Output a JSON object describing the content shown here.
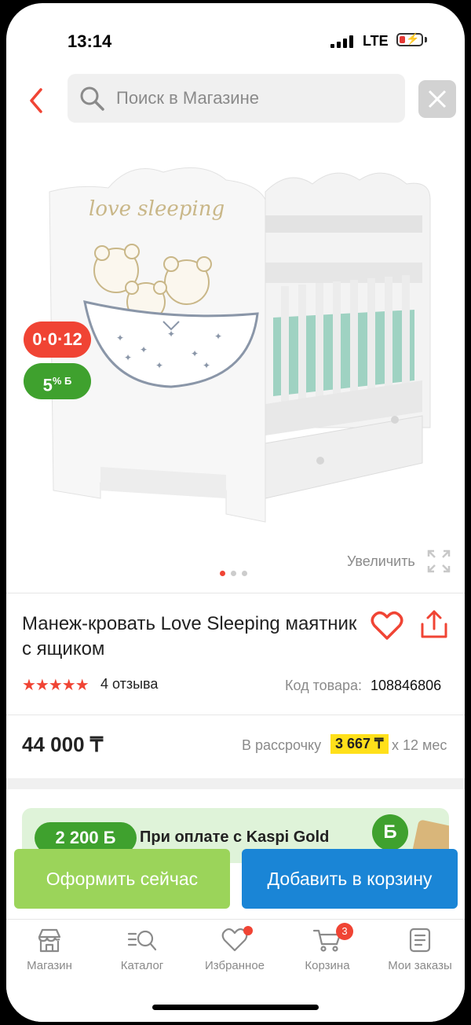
{
  "status_bar": {
    "time": "13:14",
    "network": "LTE"
  },
  "search": {
    "placeholder": "Поиск в Магазине"
  },
  "product": {
    "badges": {
      "installment": "0·0·12",
      "bonus_value": "5",
      "bonus_suffix": "% Б"
    },
    "carousel": {
      "total": 3,
      "active": 0
    },
    "zoom_label": "Увеличить",
    "title": "Манеж-кровать Love Sleeping маятник с ящиком",
    "rating": 5,
    "rating_stars": "★★★★★",
    "reviews": "4 отзыва",
    "code_label": "Код товара:",
    "code_value": "108846806",
    "price": "44 000 ₸",
    "installment_label": "В рассрочку",
    "installment_value": "3 667 ₸",
    "installment_term": "x 12 мес"
  },
  "promo": {
    "badge": "2 200 Б",
    "text": "При оплате с Kaspi Gold",
    "coin": "Б"
  },
  "actions": {
    "buy_now": "Оформить сейчас",
    "add_to_cart": "Добавить в корзину"
  },
  "bottom_nav": [
    {
      "label": "Магазин",
      "icon": "store-icon"
    },
    {
      "label": "Каталог",
      "icon": "catalog-search-icon"
    },
    {
      "label": "Избранное",
      "icon": "heart-icon"
    },
    {
      "label": "Корзина",
      "icon": "cart-icon",
      "badge": "3"
    },
    {
      "label": "Мои заказы",
      "icon": "orders-icon"
    }
  ],
  "colors": {
    "accent_red": "#f04434",
    "kaspi_green": "#3fa12e",
    "blue": "#1a85d6",
    "light_green": "#9bd45a"
  }
}
